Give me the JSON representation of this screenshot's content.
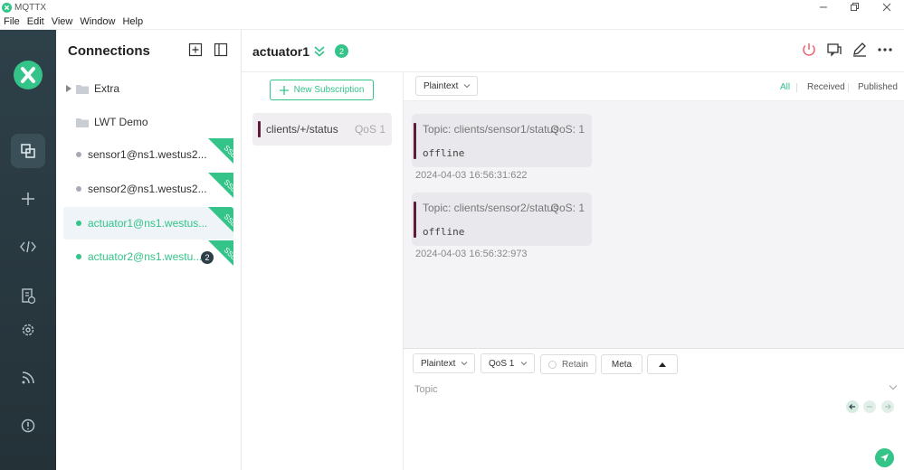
{
  "window": {
    "title": "MQTTX"
  },
  "menu": [
    "File",
    "Edit",
    "View",
    "Window",
    "Help"
  ],
  "connections_panel": {
    "title": "Connections",
    "items": [
      {
        "name": "Extra",
        "type": "folder",
        "collapsed": true
      },
      {
        "name": "LWT Demo",
        "type": "folder"
      },
      {
        "name": "sensor1@ns1.westus2...",
        "status": "offline",
        "ssl": "SSL"
      },
      {
        "name": "sensor2@ns1.westus2...",
        "status": "offline",
        "ssl": "SSL"
      },
      {
        "name": "actuator1@ns1.westus...",
        "status": "online",
        "ssl": "SSL",
        "active": true
      },
      {
        "name": "actuator2@ns1.westu...",
        "status": "online",
        "ssl": "SSL",
        "unread": "2"
      }
    ]
  },
  "header": {
    "connection_name": "actuator1",
    "unread_count": "2"
  },
  "subscriptions": {
    "new_button": "New Subscription",
    "items": [
      {
        "topic": "clients/+/status",
        "qos": "QoS 1",
        "color": "#5c1c3a"
      }
    ]
  },
  "messages": {
    "format": "Plaintext",
    "filters": [
      "All",
      "Received",
      "Published"
    ],
    "active_filter": "All",
    "items": [
      {
        "topic": "Topic: clients/sensor1/status",
        "qos": "QoS: 1",
        "payload": "offline",
        "time": "2024-04-03 16:56:31:622"
      },
      {
        "topic": "Topic: clients/sensor2/status",
        "qos": "QoS: 1",
        "payload": "offline",
        "time": "2024-04-03 16:56:32:973"
      }
    ]
  },
  "publish": {
    "format": "Plaintext",
    "qos": "QoS 1",
    "retain": "Retain",
    "meta": "Meta",
    "topic_placeholder": "Topic"
  },
  "colors": {
    "accent": "#34c388",
    "sidebar": "#2e4049",
    "topic_bar": "#5c1c3a"
  }
}
